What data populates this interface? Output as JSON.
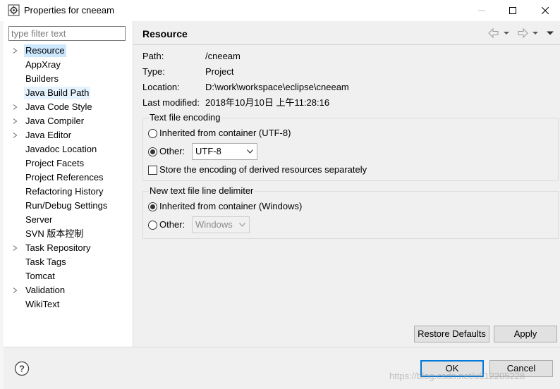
{
  "window": {
    "title": "Properties for cneeam",
    "icon": "eclipse-gear-icon"
  },
  "filter": {
    "placeholder": "type filter text",
    "value": ""
  },
  "tree": [
    {
      "label": "Resource",
      "expandable": true,
      "state": "selected"
    },
    {
      "label": "AppXray",
      "expandable": false
    },
    {
      "label": "Builders",
      "expandable": false
    },
    {
      "label": "Java Build Path",
      "expandable": false,
      "state": "hover"
    },
    {
      "label": "Java Code Style",
      "expandable": true
    },
    {
      "label": "Java Compiler",
      "expandable": true
    },
    {
      "label": "Java Editor",
      "expandable": true
    },
    {
      "label": "Javadoc Location",
      "expandable": false
    },
    {
      "label": "Project Facets",
      "expandable": false
    },
    {
      "label": "Project References",
      "expandable": false
    },
    {
      "label": "Refactoring History",
      "expandable": false
    },
    {
      "label": "Run/Debug Settings",
      "expandable": false
    },
    {
      "label": "Server",
      "expandable": false
    },
    {
      "label": "SVN 版本控制",
      "expandable": false
    },
    {
      "label": "Task Repository",
      "expandable": true
    },
    {
      "label": "Task Tags",
      "expandable": false
    },
    {
      "label": "Tomcat",
      "expandable": false
    },
    {
      "label": "Validation",
      "expandable": true
    },
    {
      "label": "WikiText",
      "expandable": false
    }
  ],
  "page": {
    "heading": "Resource",
    "props": {
      "path": {
        "label": "Path:",
        "value": "/cneeam"
      },
      "type": {
        "label": "Type:",
        "value": "Project"
      },
      "location": {
        "label": "Location:",
        "value": "D:\\work\\workspace\\eclipse\\cneeam"
      },
      "modified": {
        "label": "Last modified:",
        "value": "2018年10月10日 上午11:28:16"
      }
    },
    "encoding": {
      "title": "Text file encoding",
      "inherited_label": "Inherited from container (UTF-8)",
      "other_label": "Other:",
      "other_value": "UTF-8",
      "selected": "other",
      "derived_label": "Store the encoding of derived resources separately",
      "derived_checked": false
    },
    "delimiter": {
      "title": "New text file line delimiter",
      "inherited_label": "Inherited from container (Windows)",
      "other_label": "Other:",
      "other_value": "Windows",
      "selected": "inherited"
    }
  },
  "buttons": {
    "restore": "Restore Defaults",
    "apply": "Apply",
    "ok": "OK",
    "cancel": "Cancel"
  },
  "watermark": "https://blog.csdn.net/u012205228",
  "colors": {
    "selection": "#cce8ff",
    "hover": "#e5f3ff",
    "default_button_border": "#0078d7"
  }
}
